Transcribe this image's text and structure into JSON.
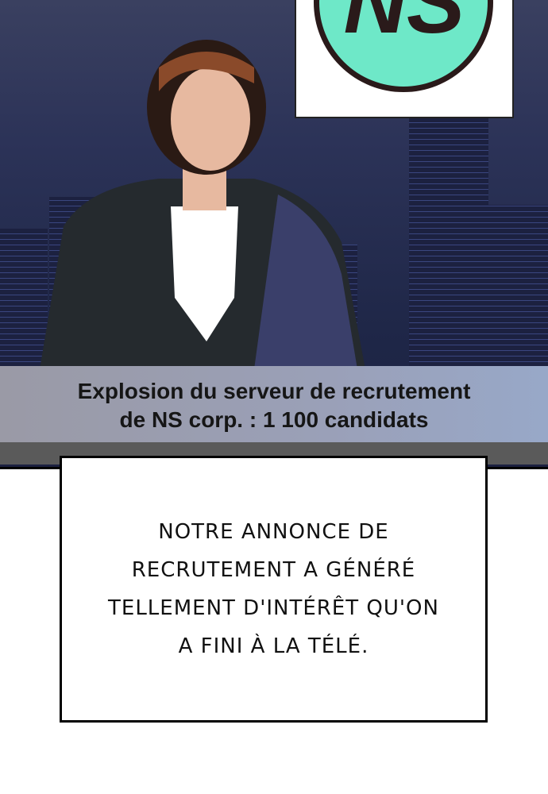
{
  "logo": {
    "text": "NS",
    "color": "#6ee8c8"
  },
  "ticker": {
    "line1": "Explosion du serveur de recrutement",
    "line2": "de NS corp. : 1 100 candidats"
  },
  "caption": {
    "lines": [
      "NOTRE ANNONCE DE",
      "RECRUTEMENT A GÉNÉRÉ",
      "TELLEMENT D'INTÉRÊT QU'ON",
      "A FINI À LA TÉLÉ."
    ]
  }
}
